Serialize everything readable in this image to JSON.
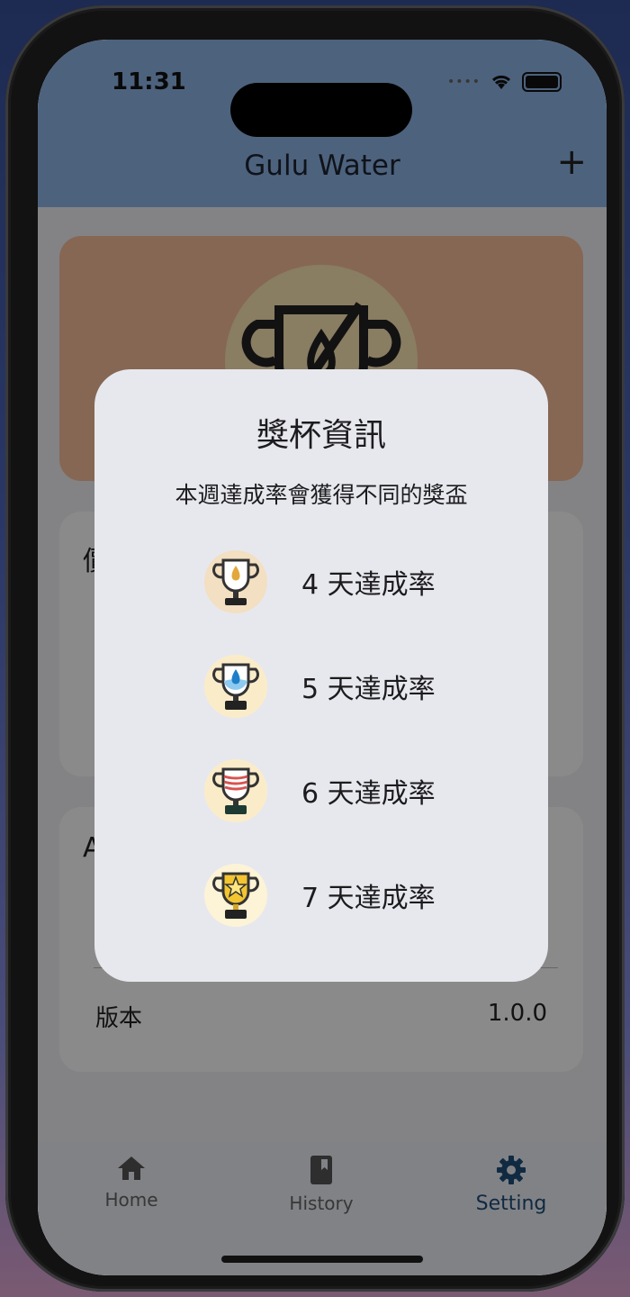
{
  "status": {
    "time": "11:31"
  },
  "appbar": {
    "title": "Gulu Water",
    "add_label": "+"
  },
  "cards": {
    "goal_card_label": "價",
    "about_card_label": "A",
    "version_label": "版本",
    "version_value": "1.0.0"
  },
  "dialog": {
    "title": "獎杯資訊",
    "subtitle": "本週達成率會獲得不同的獎盃",
    "awards": [
      {
        "label": "4 天達成率",
        "icon": "trophy-drop-icon",
        "bg": "#f3dfc1"
      },
      {
        "label": "5 天達成率",
        "icon": "trophy-water-icon",
        "bg": "#fbecc9"
      },
      {
        "label": "6 天達成率",
        "icon": "trophy-wave-icon",
        "bg": "#fbecc9"
      },
      {
        "label": "7 天達成率",
        "icon": "trophy-star-icon",
        "bg": "#fdf3d6"
      }
    ]
  },
  "nav": {
    "items": [
      {
        "label": "Home",
        "icon": "home-icon"
      },
      {
        "label": "History",
        "icon": "book-icon"
      },
      {
        "label": "Setting",
        "icon": "gear-icon",
        "active": true
      }
    ]
  }
}
